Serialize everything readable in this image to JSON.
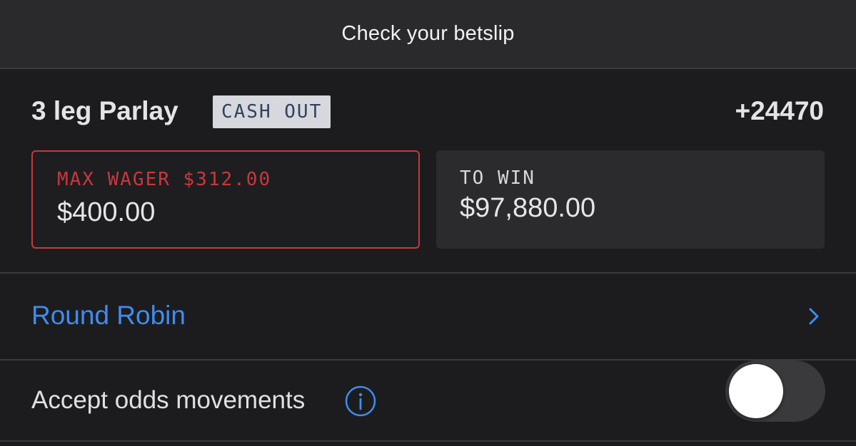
{
  "header": {
    "title": "Check your betslip"
  },
  "bet": {
    "title": "3 leg Parlay",
    "badge": "CASH OUT",
    "odds": "+24470",
    "wager": {
      "label": "MAX WAGER $312.00",
      "value": "$400.00"
    },
    "to_win": {
      "label": "TO WIN",
      "value": "$97,880.00"
    }
  },
  "round_robin": {
    "label": "Round Robin",
    "icon": "chevron-right-icon"
  },
  "odds_movement": {
    "label": "Accept odds movements",
    "info_icon": "info-icon",
    "toggle_on": false
  },
  "colors": {
    "background": "#1c1c1e",
    "header_bg": "#2a2a2c",
    "accent_blue": "#3f8cf0",
    "error_red": "#c8383d",
    "badge_bg": "#d6d8de",
    "badge_text": "#33415c"
  }
}
